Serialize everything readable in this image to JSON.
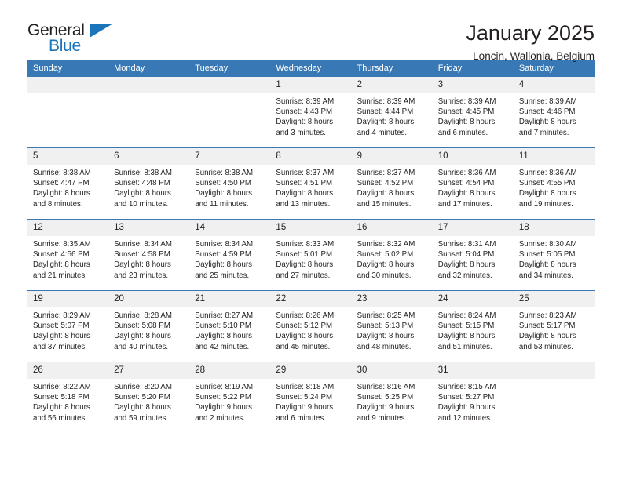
{
  "brand": {
    "name_part1": "General",
    "name_part2": "Blue",
    "accent_color": "#1b75bb"
  },
  "header": {
    "title": "January 2025",
    "location": "Loncin, Wallonia, Belgium"
  },
  "theme": {
    "header_blue": "#3878b4",
    "daynum_band": "#f0f0f0",
    "text": "#231f20"
  },
  "calendar": {
    "weekday_headers": [
      "Sunday",
      "Monday",
      "Tuesday",
      "Wednesday",
      "Thursday",
      "Friday",
      "Saturday"
    ],
    "weeks": [
      [
        {
          "day": "",
          "empty": true,
          "sunrise": "",
          "sunset": "",
          "daylight_line1": "",
          "daylight_line2": ""
        },
        {
          "day": "",
          "empty": true,
          "sunrise": "",
          "sunset": "",
          "daylight_line1": "",
          "daylight_line2": ""
        },
        {
          "day": "",
          "empty": true,
          "sunrise": "",
          "sunset": "",
          "daylight_line1": "",
          "daylight_line2": ""
        },
        {
          "day": "1",
          "empty": false,
          "sunrise": "Sunrise: 8:39 AM",
          "sunset": "Sunset: 4:43 PM",
          "daylight_line1": "Daylight: 8 hours",
          "daylight_line2": "and 3 minutes."
        },
        {
          "day": "2",
          "empty": false,
          "sunrise": "Sunrise: 8:39 AM",
          "sunset": "Sunset: 4:44 PM",
          "daylight_line1": "Daylight: 8 hours",
          "daylight_line2": "and 4 minutes."
        },
        {
          "day": "3",
          "empty": false,
          "sunrise": "Sunrise: 8:39 AM",
          "sunset": "Sunset: 4:45 PM",
          "daylight_line1": "Daylight: 8 hours",
          "daylight_line2": "and 6 minutes."
        },
        {
          "day": "4",
          "empty": false,
          "sunrise": "Sunrise: 8:39 AM",
          "sunset": "Sunset: 4:46 PM",
          "daylight_line1": "Daylight: 8 hours",
          "daylight_line2": "and 7 minutes."
        }
      ],
      [
        {
          "day": "5",
          "empty": false,
          "sunrise": "Sunrise: 8:38 AM",
          "sunset": "Sunset: 4:47 PM",
          "daylight_line1": "Daylight: 8 hours",
          "daylight_line2": "and 8 minutes."
        },
        {
          "day": "6",
          "empty": false,
          "sunrise": "Sunrise: 8:38 AM",
          "sunset": "Sunset: 4:48 PM",
          "daylight_line1": "Daylight: 8 hours",
          "daylight_line2": "and 10 minutes."
        },
        {
          "day": "7",
          "empty": false,
          "sunrise": "Sunrise: 8:38 AM",
          "sunset": "Sunset: 4:50 PM",
          "daylight_line1": "Daylight: 8 hours",
          "daylight_line2": "and 11 minutes."
        },
        {
          "day": "8",
          "empty": false,
          "sunrise": "Sunrise: 8:37 AM",
          "sunset": "Sunset: 4:51 PM",
          "daylight_line1": "Daylight: 8 hours",
          "daylight_line2": "and 13 minutes."
        },
        {
          "day": "9",
          "empty": false,
          "sunrise": "Sunrise: 8:37 AM",
          "sunset": "Sunset: 4:52 PM",
          "daylight_line1": "Daylight: 8 hours",
          "daylight_line2": "and 15 minutes."
        },
        {
          "day": "10",
          "empty": false,
          "sunrise": "Sunrise: 8:36 AM",
          "sunset": "Sunset: 4:54 PM",
          "daylight_line1": "Daylight: 8 hours",
          "daylight_line2": "and 17 minutes."
        },
        {
          "day": "11",
          "empty": false,
          "sunrise": "Sunrise: 8:36 AM",
          "sunset": "Sunset: 4:55 PM",
          "daylight_line1": "Daylight: 8 hours",
          "daylight_line2": "and 19 minutes."
        }
      ],
      [
        {
          "day": "12",
          "empty": false,
          "sunrise": "Sunrise: 8:35 AM",
          "sunset": "Sunset: 4:56 PM",
          "daylight_line1": "Daylight: 8 hours",
          "daylight_line2": "and 21 minutes."
        },
        {
          "day": "13",
          "empty": false,
          "sunrise": "Sunrise: 8:34 AM",
          "sunset": "Sunset: 4:58 PM",
          "daylight_line1": "Daylight: 8 hours",
          "daylight_line2": "and 23 minutes."
        },
        {
          "day": "14",
          "empty": false,
          "sunrise": "Sunrise: 8:34 AM",
          "sunset": "Sunset: 4:59 PM",
          "daylight_line1": "Daylight: 8 hours",
          "daylight_line2": "and 25 minutes."
        },
        {
          "day": "15",
          "empty": false,
          "sunrise": "Sunrise: 8:33 AM",
          "sunset": "Sunset: 5:01 PM",
          "daylight_line1": "Daylight: 8 hours",
          "daylight_line2": "and 27 minutes."
        },
        {
          "day": "16",
          "empty": false,
          "sunrise": "Sunrise: 8:32 AM",
          "sunset": "Sunset: 5:02 PM",
          "daylight_line1": "Daylight: 8 hours",
          "daylight_line2": "and 30 minutes."
        },
        {
          "day": "17",
          "empty": false,
          "sunrise": "Sunrise: 8:31 AM",
          "sunset": "Sunset: 5:04 PM",
          "daylight_line1": "Daylight: 8 hours",
          "daylight_line2": "and 32 minutes."
        },
        {
          "day": "18",
          "empty": false,
          "sunrise": "Sunrise: 8:30 AM",
          "sunset": "Sunset: 5:05 PM",
          "daylight_line1": "Daylight: 8 hours",
          "daylight_line2": "and 34 minutes."
        }
      ],
      [
        {
          "day": "19",
          "empty": false,
          "sunrise": "Sunrise: 8:29 AM",
          "sunset": "Sunset: 5:07 PM",
          "daylight_line1": "Daylight: 8 hours",
          "daylight_line2": "and 37 minutes."
        },
        {
          "day": "20",
          "empty": false,
          "sunrise": "Sunrise: 8:28 AM",
          "sunset": "Sunset: 5:08 PM",
          "daylight_line1": "Daylight: 8 hours",
          "daylight_line2": "and 40 minutes."
        },
        {
          "day": "21",
          "empty": false,
          "sunrise": "Sunrise: 8:27 AM",
          "sunset": "Sunset: 5:10 PM",
          "daylight_line1": "Daylight: 8 hours",
          "daylight_line2": "and 42 minutes."
        },
        {
          "day": "22",
          "empty": false,
          "sunrise": "Sunrise: 8:26 AM",
          "sunset": "Sunset: 5:12 PM",
          "daylight_line1": "Daylight: 8 hours",
          "daylight_line2": "and 45 minutes."
        },
        {
          "day": "23",
          "empty": false,
          "sunrise": "Sunrise: 8:25 AM",
          "sunset": "Sunset: 5:13 PM",
          "daylight_line1": "Daylight: 8 hours",
          "daylight_line2": "and 48 minutes."
        },
        {
          "day": "24",
          "empty": false,
          "sunrise": "Sunrise: 8:24 AM",
          "sunset": "Sunset: 5:15 PM",
          "daylight_line1": "Daylight: 8 hours",
          "daylight_line2": "and 51 minutes."
        },
        {
          "day": "25",
          "empty": false,
          "sunrise": "Sunrise: 8:23 AM",
          "sunset": "Sunset: 5:17 PM",
          "daylight_line1": "Daylight: 8 hours",
          "daylight_line2": "and 53 minutes."
        }
      ],
      [
        {
          "day": "26",
          "empty": false,
          "sunrise": "Sunrise: 8:22 AM",
          "sunset": "Sunset: 5:18 PM",
          "daylight_line1": "Daylight: 8 hours",
          "daylight_line2": "and 56 minutes."
        },
        {
          "day": "27",
          "empty": false,
          "sunrise": "Sunrise: 8:20 AM",
          "sunset": "Sunset: 5:20 PM",
          "daylight_line1": "Daylight: 8 hours",
          "daylight_line2": "and 59 minutes."
        },
        {
          "day": "28",
          "empty": false,
          "sunrise": "Sunrise: 8:19 AM",
          "sunset": "Sunset: 5:22 PM",
          "daylight_line1": "Daylight: 9 hours",
          "daylight_line2": "and 2 minutes."
        },
        {
          "day": "29",
          "empty": false,
          "sunrise": "Sunrise: 8:18 AM",
          "sunset": "Sunset: 5:24 PM",
          "daylight_line1": "Daylight: 9 hours",
          "daylight_line2": "and 6 minutes."
        },
        {
          "day": "30",
          "empty": false,
          "sunrise": "Sunrise: 8:16 AM",
          "sunset": "Sunset: 5:25 PM",
          "daylight_line1": "Daylight: 9 hours",
          "daylight_line2": "and 9 minutes."
        },
        {
          "day": "31",
          "empty": false,
          "sunrise": "Sunrise: 8:15 AM",
          "sunset": "Sunset: 5:27 PM",
          "daylight_line1": "Daylight: 9 hours",
          "daylight_line2": "and 12 minutes."
        },
        {
          "day": "",
          "empty": true,
          "sunrise": "",
          "sunset": "",
          "daylight_line1": "",
          "daylight_line2": ""
        }
      ]
    ]
  }
}
